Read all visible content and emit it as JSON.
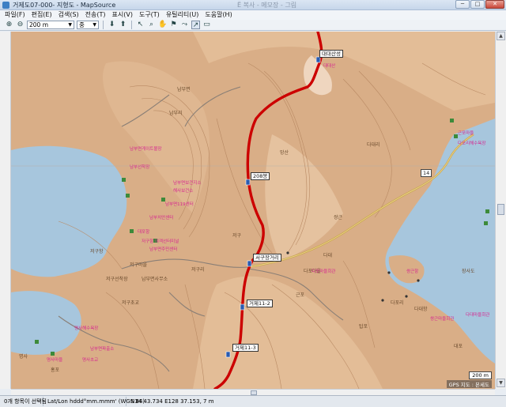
{
  "window": {
    "title": "거제도07-000- 지형도 - MapSource",
    "faint_title": "Ё 복사 - 메모장 - 그림",
    "buttons": [
      "─",
      "□",
      "✕"
    ]
  },
  "menu": [
    "파일(F)",
    "편집(E)",
    "검색(S)",
    "전송(T)",
    "표시(V)",
    "도구(T)",
    "유틸리티(U)",
    "도움말(H)"
  ],
  "toolbar": {
    "zoom_in": "⊕",
    "zoom_out": "⊖",
    "scale_value": "200 m",
    "detail_value": "중"
  },
  "map": {
    "labels": {
      "dae_sa": "대대산성",
      "peak": "208봉",
      "pass": "서구장거리",
      "wp2": "거제11-2",
      "wp3": "거제11-3",
      "route14": "14"
    },
    "place_names": [
      "남부면",
      "저구리",
      "저구마을",
      "저구항",
      "다포리",
      "쌍근",
      "명사",
      "홍포",
      "대포",
      "근포",
      "탑포",
      "저구",
      "남부리",
      "다대리",
      "망산",
      "장사도",
      "저구초교",
      "다대",
      "남부면사무소",
      "다포마을",
      "저구선착장",
      "다대항"
    ],
    "pink_labels": [
      "남부면게이트볼장",
      "대대산",
      "남부선착장",
      "남부면보건지소",
      "해사보건소",
      "남부면119센터",
      "근포마을",
      "다포리해수욕장",
      "남부치안센터",
      "대포항",
      "저구항 여객선터미널",
      "남부면주민센터",
      "다포마을회관",
      "쌍근항",
      "명사해수욕장",
      "쌍근마을회관",
      "다대마을회관",
      "남부면파출소",
      "명사마을",
      "명사초교"
    ],
    "scale_text": "200 m",
    "credit_text": "GPS 지도 : 본세도"
  },
  "status": {
    "selection": "0개 항목이 선택됨",
    "coord_format": "Lat/Lon hddd°mm.mmm' (WGS 84)",
    "position": "N34 43.734 E128 37.153, 7 m"
  },
  "colors": {
    "track": "#cc0000",
    "sea": "#a7c6dd",
    "land": "#d9ae87",
    "ridge": "#e6c8a8",
    "road": "#c9a64a"
  }
}
